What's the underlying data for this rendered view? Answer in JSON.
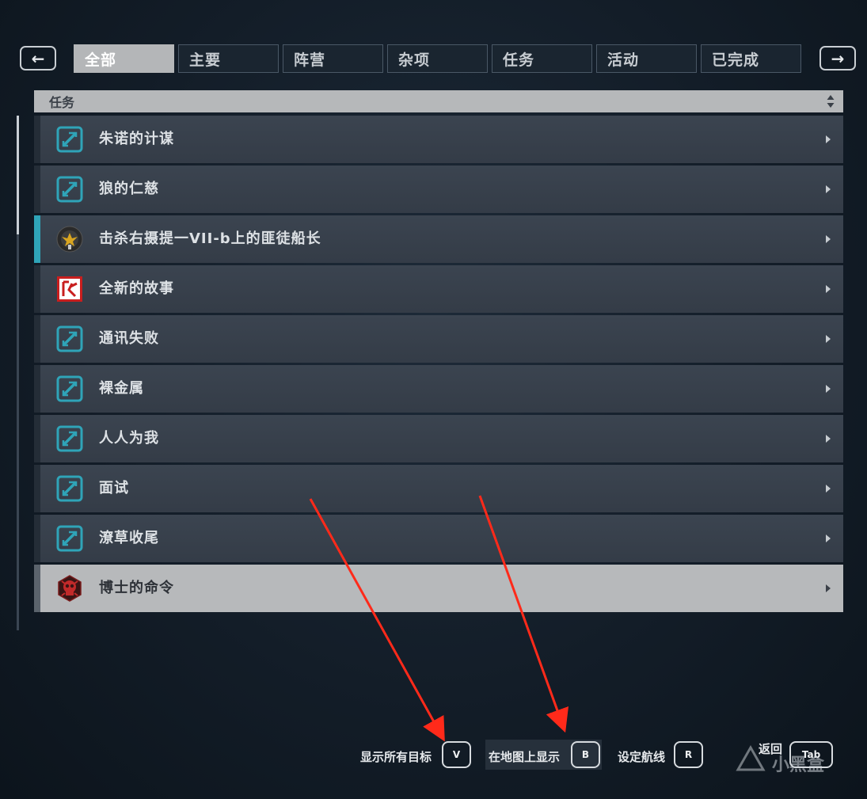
{
  "nav": {
    "prev_icon": "←",
    "next_icon": "→",
    "tabs": [
      {
        "label": "全部",
        "active": true
      },
      {
        "label": "主要",
        "active": false
      },
      {
        "label": "阵营",
        "active": false
      },
      {
        "label": "杂项",
        "active": false
      },
      {
        "label": "任务",
        "active": false
      },
      {
        "label": "活动",
        "active": false
      },
      {
        "label": "已完成",
        "active": false
      }
    ]
  },
  "list": {
    "sort_header": "任务",
    "quests": [
      {
        "title": "朱诺的计谋",
        "icon": "mission-icon"
      },
      {
        "title": "狼的仁慈",
        "icon": "mission-icon"
      },
      {
        "title": "击杀右摄提一VII-b上的匪徒船长",
        "icon": "faction-emblem-icon",
        "tracked": true
      },
      {
        "title": "全新的故事",
        "icon": "red-faction-icon"
      },
      {
        "title": "通讯失败",
        "icon": "mission-icon"
      },
      {
        "title": "裸金属",
        "icon": "mission-icon"
      },
      {
        "title": "人人为我",
        "icon": "mission-icon"
      },
      {
        "title": "面试",
        "icon": "mission-icon"
      },
      {
        "title": "潦草收尾",
        "icon": "mission-icon"
      },
      {
        "title": "博士的命令",
        "icon": "skull-emblem-icon",
        "selected": true
      }
    ]
  },
  "hints": {
    "show_all_targets": {
      "label": "显示所有目标",
      "key": "V"
    },
    "show_on_map": {
      "label": "在地图上显示",
      "key": "B"
    },
    "set_course": {
      "label": "设定航线",
      "key": "R"
    },
    "back": {
      "label": "返回",
      "key": "Tab"
    }
  },
  "watermark": "小黑盒",
  "colors": {
    "accent_teal": "#2fa4b8",
    "annotation_red": "#ff2a1a",
    "selected_row": "#b7b9bb"
  }
}
